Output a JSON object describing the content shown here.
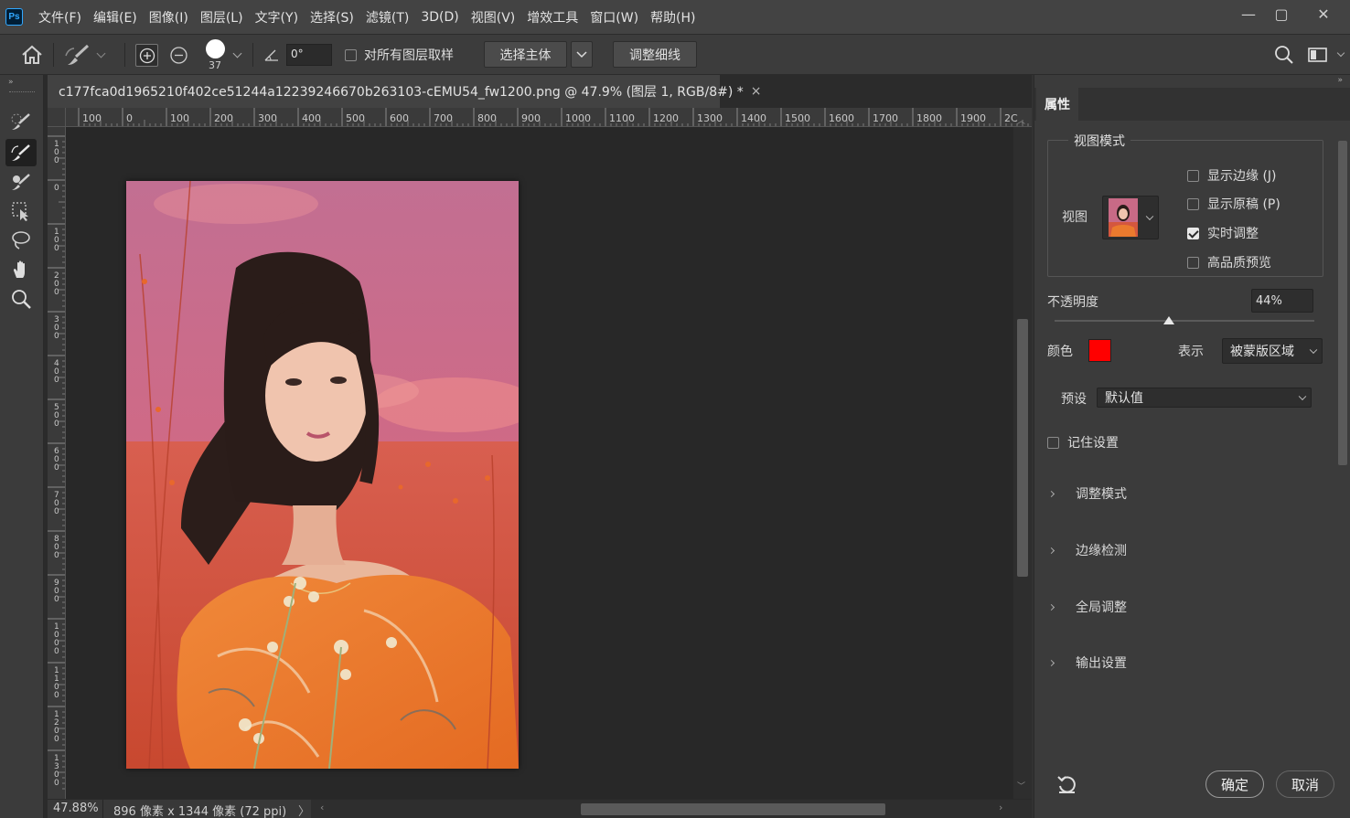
{
  "app": {
    "logo_text": "Ps"
  },
  "menu": [
    "文件(F)",
    "编辑(E)",
    "图像(I)",
    "图层(L)",
    "文字(Y)",
    "选择(S)",
    "滤镜(T)",
    "3D(D)",
    "视图(V)",
    "增效工具",
    "窗口(W)",
    "帮助(H)"
  ],
  "window_controls": {
    "minimize": "—",
    "maximize": "▢",
    "close": "✕"
  },
  "options": {
    "brush_size": "37",
    "angle_value": "0°",
    "sample_all_label": "对所有图层取样",
    "select_subject_label": "选择主体",
    "refine_hair_label": "调整细线"
  },
  "document": {
    "tab_title": "c177fca0d1965210f402ce51244a12239246670b263103-cEMU54_fw1200.png @ 47.9% (图层 1, RGB/8#) *",
    "tab_close": "×"
  },
  "ruler_h_labels": [
    "100",
    "0",
    "100",
    "200",
    "300",
    "400",
    "500",
    "600",
    "700",
    "800",
    "900",
    "1000",
    "1100",
    "1200",
    "1300",
    "1400",
    "1500",
    "1600",
    "1700",
    "1800",
    "1900",
    "2C"
  ],
  "ruler_v_labels": [
    "1\n0\n0",
    "0",
    "1\n0\n0",
    "2\n0\n0",
    "3\n0\n0",
    "4\n0\n0",
    "5\n0\n0",
    "6\n0\n0",
    "7\n0\n0",
    "8\n0\n0",
    "9\n0\n0",
    "1\n0\n0\n0",
    "1\n1\n0\n0",
    "1\n2\n0\n0",
    "1\n3\n0\n0"
  ],
  "status": {
    "zoom": "47.88%",
    "doc_size": "896 像素 x 1344 像素 (72 ppi)",
    "arrow": "〉"
  },
  "properties": {
    "tab_label": "属性",
    "view_mode_legend": "视图模式",
    "view_label": "视图",
    "checkboxes": [
      {
        "label": "显示边缘 (J)",
        "checked": false
      },
      {
        "label": "显示原稿 (P)",
        "checked": false
      },
      {
        "label": "实时调整",
        "checked": true
      },
      {
        "label": "高品质预览",
        "checked": false
      }
    ],
    "opacity_label": "不透明度",
    "opacity_value": "44%",
    "opacity_fraction": 0.44,
    "color_label": "颜色",
    "overlay_color": "#ff0000",
    "display_label": "表示",
    "display_value": "被蒙版区域",
    "preset_label": "预设",
    "preset_value": "默认值",
    "remember_label": "记住设置",
    "sections": [
      "调整模式",
      "边缘检测",
      "全局调整",
      "输出设置"
    ],
    "ok_label": "确定",
    "cancel_label": "取消"
  }
}
